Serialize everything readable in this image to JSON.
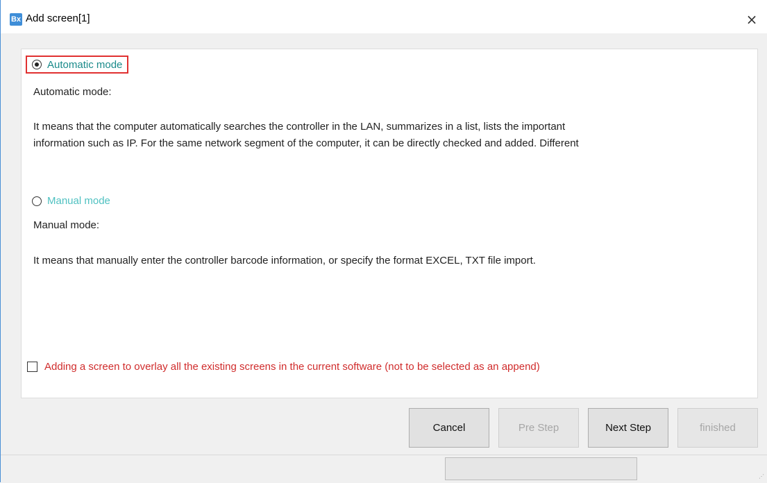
{
  "window": {
    "title": "Add screen[1]",
    "app_icon_text": "Bx",
    "close_glyph": "×"
  },
  "options": {
    "automatic": {
      "label": "Automatic mode",
      "selected": true,
      "heading": "Automatic mode:",
      "description_line1": "It means that the computer automatically searches the controller in the LAN, summarizes in a list, lists the important",
      "description_line2": "information such as IP. For the same network segment of the computer, it can be directly checked and added. Different"
    },
    "manual": {
      "label": "Manual mode",
      "selected": false,
      "heading": "Manual mode:",
      "description": "It means that manually enter the controller barcode information, or specify the format EXCEL, TXT file import."
    }
  },
  "overlay_checkbox": {
    "label": "Adding a screen to overlay all the existing screens in the current software (not to be selected as an append)",
    "checked": false
  },
  "buttons": {
    "cancel": "Cancel",
    "pre_step": "Pre Step",
    "next_step": "Next Step",
    "finished": "finished"
  },
  "colors": {
    "selected_option": "#1a8a8a",
    "unselected_option": "#4fc1c1",
    "highlight_border": "#e03030",
    "warning_text": "#d02c2c"
  },
  "progress": {
    "value": 0
  }
}
